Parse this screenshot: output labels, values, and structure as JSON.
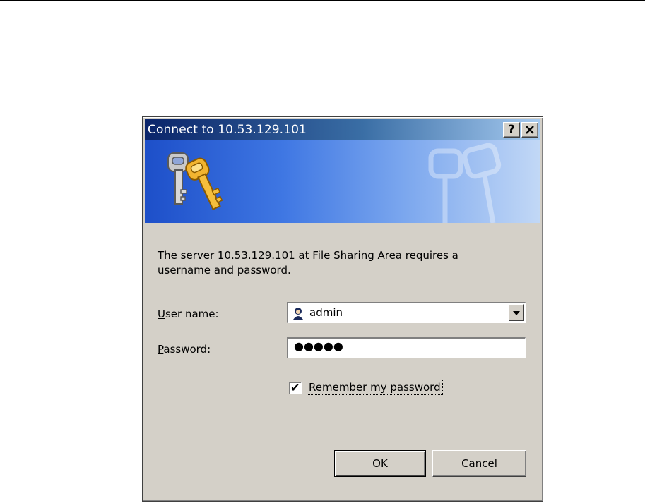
{
  "window": {
    "title": "Connect to 10.53.129.101",
    "help_label": "?",
    "close_label": "✕"
  },
  "banner": {
    "icon": "keys-icon"
  },
  "message": "The server 10.53.129.101 at File Sharing Area requires a username and password.",
  "form": {
    "username_label_accel": "U",
    "username_label_rest": "ser name:",
    "username_value": "admin",
    "password_label_accel": "P",
    "password_label_rest": "assword:",
    "password_value": "●●●●●",
    "remember_accel": "R",
    "remember_rest": "emember my password",
    "remember_checked": true
  },
  "buttons": {
    "ok": "OK",
    "cancel": "Cancel"
  },
  "colors": {
    "dialog_bg": "#d4d0c8",
    "titlebar_start": "#0a246a",
    "titlebar_end": "#a6caf0",
    "banner_blue": "#3f77e3"
  }
}
